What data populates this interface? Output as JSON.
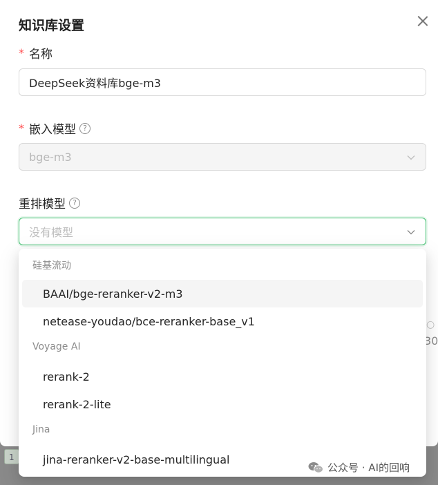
{
  "dialog": {
    "title": "知识库设置"
  },
  "name_field": {
    "required_mark": "*",
    "label": "名称",
    "value": "DeepSeek资料库bge-m3"
  },
  "embedding_field": {
    "required_mark": "*",
    "label": "嵌入模型",
    "help": "?",
    "value": "bge-m3"
  },
  "rerank_field": {
    "label": "重排模型",
    "help": "?",
    "placeholder": "没有模型"
  },
  "background_hint": {
    "circle": "○",
    "number": "30"
  },
  "backdrop_chip": "1",
  "dropdown": {
    "groups": [
      {
        "label": "硅基流动",
        "options": [
          "BAAI/bge-reranker-v2-m3",
          "netease-youdao/bce-reranker-base_v1"
        ]
      },
      {
        "label": "Voyage AI",
        "options": [
          "rerank-2",
          "rerank-2-lite"
        ]
      },
      {
        "label": "Jina",
        "options": [
          "jina-reranker-v2-base-multilingual"
        ]
      }
    ]
  },
  "watermark": {
    "text": "公众号 · AI的回响"
  },
  "colors": {
    "accent": "#3fbf6f",
    "required": "#ff4d4f",
    "hover_bg": "#f5f5f5"
  }
}
